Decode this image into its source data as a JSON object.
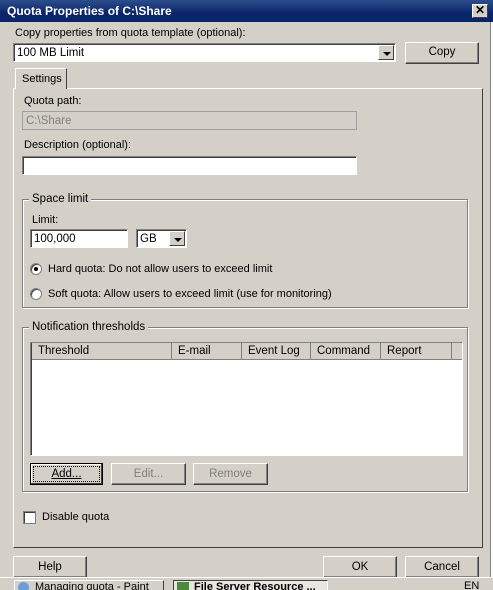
{
  "window": {
    "title": "Quota Properties of C:\\Share",
    "close_glyph": "✕"
  },
  "template": {
    "label": "Copy properties from quota template (optional):",
    "selected": "100 MB Limit",
    "copy_button": "Copy"
  },
  "tabs": [
    {
      "label": "Settings"
    }
  ],
  "quota_path": {
    "label": "Quota path:",
    "value": "C:\\Share"
  },
  "description": {
    "label": "Description (optional):",
    "value": ""
  },
  "space_limit": {
    "legend": "Space limit",
    "limit_label": "Limit:",
    "limit_value": "100,000",
    "unit": "GB",
    "hard_label": "Hard quota: Do not allow users to exceed limit",
    "soft_label": "Soft quota: Allow users to exceed limit (use for monitoring)",
    "hard_selected": true
  },
  "notification": {
    "legend": "Notification thresholds",
    "columns": [
      "Threshold",
      "E-mail",
      "Event Log",
      "Command",
      "Report"
    ],
    "add_button": "Add...",
    "edit_button": "Edit...",
    "remove_button": "Remove"
  },
  "disable_quota": {
    "label": "Disable quota",
    "checked": false
  },
  "footer": {
    "help": "Help",
    "ok": "OK",
    "cancel": "Cancel"
  },
  "taskbar": {
    "items": [
      "Managing quota - Paint",
      "File Server Resource ..."
    ],
    "lang": "EN"
  }
}
